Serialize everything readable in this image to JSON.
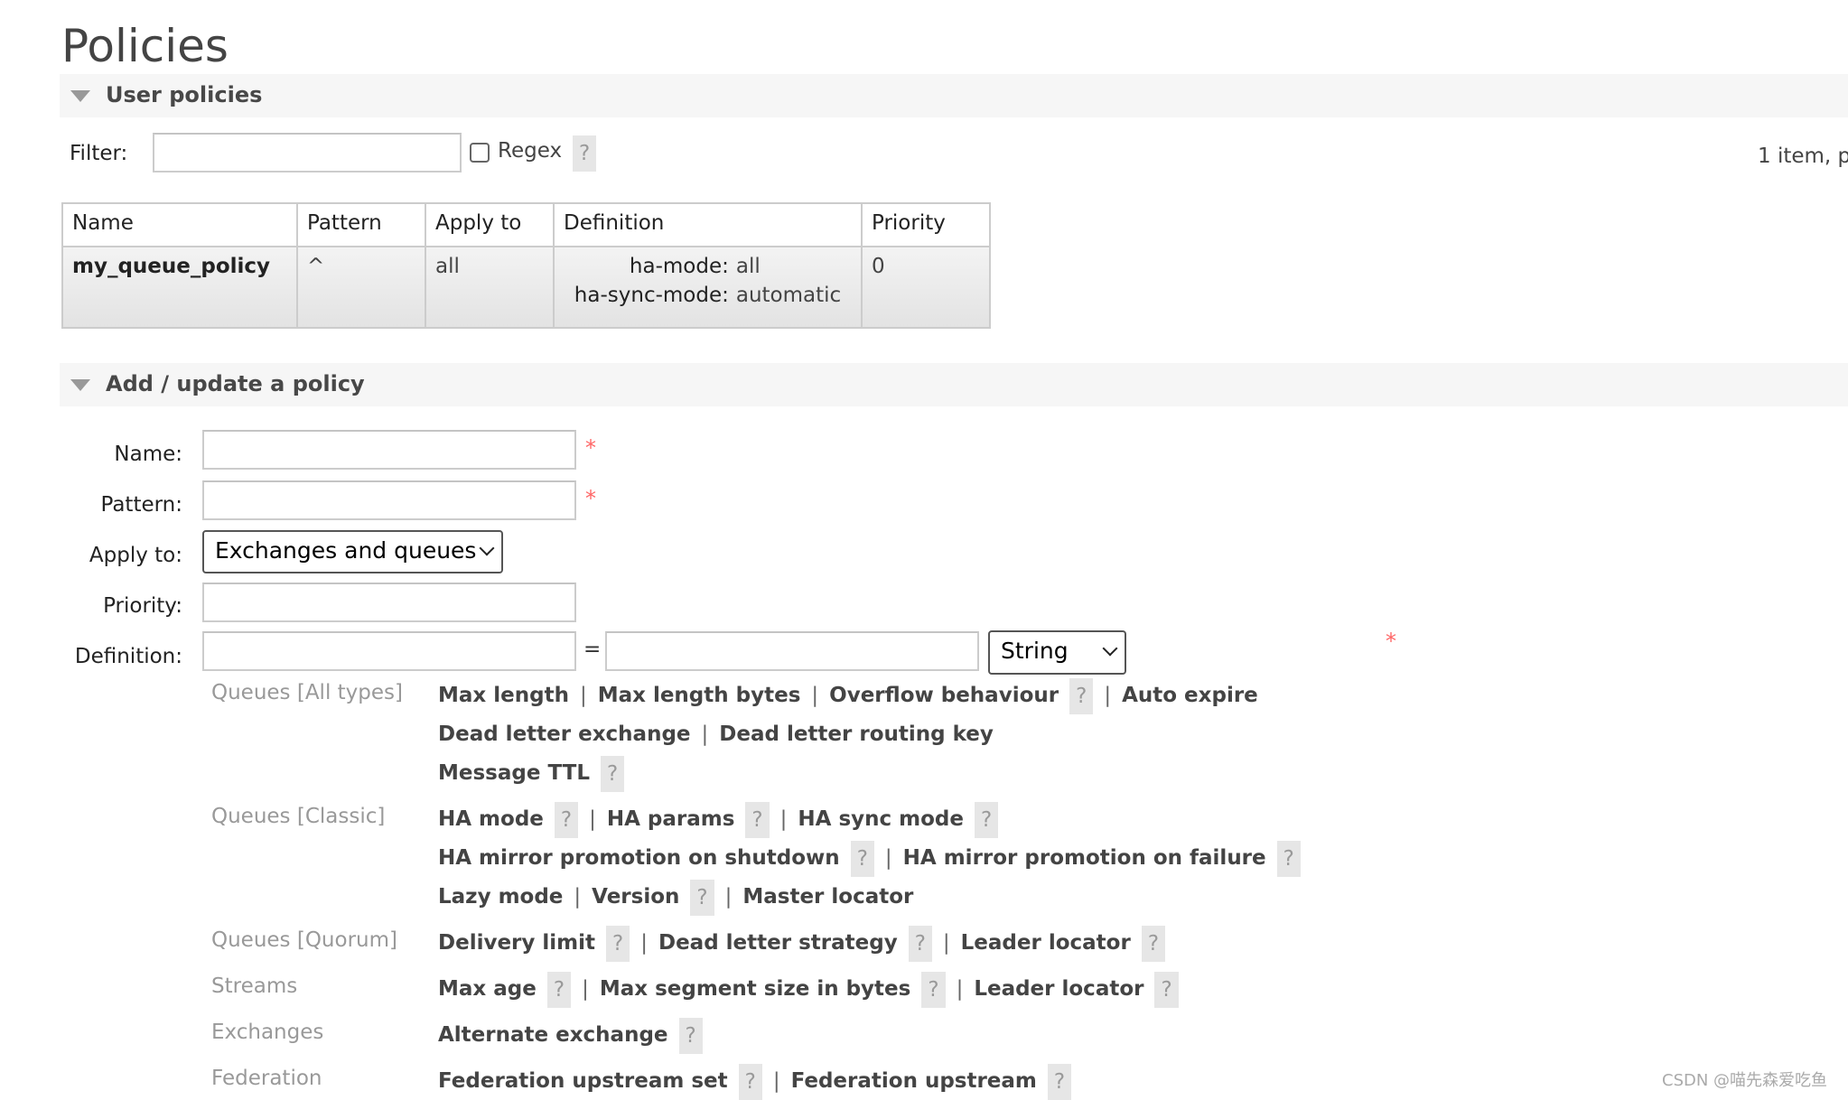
{
  "title": "Policies",
  "user_policies": {
    "section_title": "User policies",
    "filter_label": "Filter:",
    "filter_value": "",
    "regex_label": "Regex",
    "regex_checked": false,
    "help": "?",
    "pagination": "1 item, p",
    "columns": [
      "Name",
      "Pattern",
      "Apply to",
      "Definition",
      "Priority"
    ],
    "rows": [
      {
        "name": "my_queue_policy",
        "pattern": "^",
        "apply_to": "all",
        "definition": [
          {
            "key": "ha-mode:",
            "value": "all"
          },
          {
            "key": "ha-sync-mode:",
            "value": "automatic"
          }
        ],
        "priority": "0"
      }
    ]
  },
  "add_policy": {
    "section_title": "Add / update a policy",
    "name_label": "Name:",
    "pattern_label": "Pattern:",
    "apply_label": "Apply to:",
    "priority_label": "Priority:",
    "definition_label": "Definition:",
    "apply_value": "Exchanges and queues",
    "equals": "=",
    "type_value": "String",
    "required": "*",
    "help": "?",
    "groups": [
      {
        "label": "Queues [All types]",
        "lines": [
          [
            {
              "t": "Max length"
            },
            {
              "t": "Max length bytes"
            },
            {
              "t": "Overflow behaviour",
              "h": true
            },
            {
              "t": "Auto expire"
            }
          ],
          [
            {
              "t": "Dead letter exchange"
            },
            {
              "t": "Dead letter routing key"
            }
          ],
          [
            {
              "t": "Message TTL",
              "h": true
            }
          ]
        ]
      },
      {
        "label": "Queues [Classic]",
        "lines": [
          [
            {
              "t": "HA mode",
              "h": true
            },
            {
              "t": "HA params",
              "h": true
            },
            {
              "t": "HA sync mode",
              "h": true
            }
          ],
          [
            {
              "t": "HA mirror promotion on shutdown",
              "h": true
            },
            {
              "t": "HA mirror promotion on failure",
              "h": true
            }
          ],
          [
            {
              "t": "Lazy mode"
            },
            {
              "t": "Version",
              "h": true
            },
            {
              "t": "Master locator"
            }
          ]
        ]
      },
      {
        "label": "Queues [Quorum]",
        "lines": [
          [
            {
              "t": "Delivery limit",
              "h": true
            },
            {
              "t": "Dead letter strategy",
              "h": true
            },
            {
              "t": "Leader locator",
              "h": true
            }
          ]
        ]
      },
      {
        "label": "Streams",
        "lines": [
          [
            {
              "t": "Max age",
              "h": true
            },
            {
              "t": "Max segment size in bytes",
              "h": true
            },
            {
              "t": "Leader locator",
              "h": true
            }
          ]
        ]
      },
      {
        "label": "Exchanges",
        "lines": [
          [
            {
              "t": "Alternate exchange",
              "h": true
            }
          ]
        ]
      },
      {
        "label": "Federation",
        "lines": [
          [
            {
              "t": "Federation upstream set",
              "h": true
            },
            {
              "t": "Federation upstream",
              "h": true
            }
          ]
        ]
      }
    ]
  },
  "watermark": "CSDN @喵先森爱吃鱼"
}
